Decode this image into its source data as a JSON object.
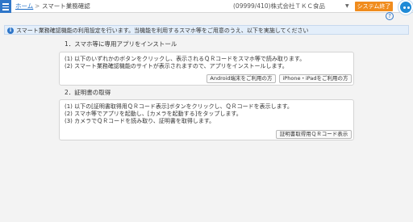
{
  "header": {
    "breadcrumb": {
      "home": "ホーム",
      "separator": ">",
      "current": "スマート業務確認"
    },
    "company": "(09999/410)株式会社ＴＫＣ食品",
    "company_caret": "▼",
    "exit_button": "システム終了",
    "help_glyph": "?"
  },
  "info": {
    "icon_glyph": "i",
    "message": "スマート業務確認機能の利用設定を行います。当機能を利用するスマホ等をご用意のうえ、以下を実施してください"
  },
  "sections": [
    {
      "title": "1．スマホ等に専用アプリをインストール",
      "lines": [
        "(1) 以下のいずれかのボタンをクリックし、表示されるＱＲコードをスマホ等で読み取ります。",
        "(2) スマート業務確認機能のサイトが表示されますので、アプリをインストールします。"
      ],
      "buttons": [
        "Android端末をご利用の方",
        "iPhone・iPadをご利用の方"
      ]
    },
    {
      "title": "2．証明書の取得",
      "lines": [
        "(1) 以下の[証明書取得用ＱＲコード表示]ボタンをクリックし、ＱＲコードを表示します。",
        "(2) スマホ等でアプリを起動し、[カメラを起動する]をタップします。",
        "(3) カメラでＱＲコードを読み取り、証明書を取得します。"
      ],
      "buttons": [
        "証明書取得用ＱＲコード表示"
      ]
    }
  ],
  "colors": {
    "accent": "#2f76c8",
    "exit": "#f08c1e",
    "info_bg": "#e3eefa"
  }
}
